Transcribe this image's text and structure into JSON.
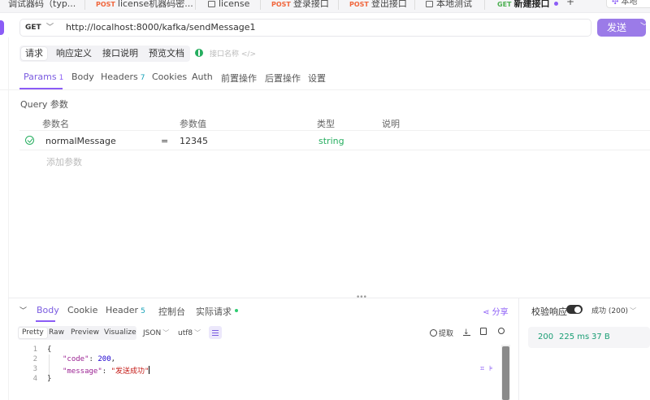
{
  "tabs": [
    {
      "method": "",
      "label": "调试器码（typ..."
    },
    {
      "method": "POST",
      "label": "license机器码密..."
    },
    {
      "method": "",
      "label": "license",
      "icon": "file-icon"
    },
    {
      "method": "POST",
      "label": "登录接口"
    },
    {
      "method": "POST",
      "label": "登出接口"
    },
    {
      "method": "",
      "label": "本地测试",
      "icon": "file-icon"
    },
    {
      "method": "GET",
      "label": "新建接口",
      "active": true
    }
  ],
  "tab_actions": {
    "add": "+",
    "more": "···",
    "env_label": "本地"
  },
  "request": {
    "method": "GET",
    "url": "http://localhost:8000/kafka/sendMessage1",
    "send_label": "发送"
  },
  "subtabs": [
    "请求",
    "响应定义",
    "接口说明",
    "预览文档"
  ],
  "api_name_placeholder": "接口名称",
  "param_tabs": [
    {
      "label": "Params",
      "count": "1",
      "active": true
    },
    {
      "label": "Body"
    },
    {
      "label": "Headers",
      "count": "7"
    },
    {
      "label": "Cookies"
    },
    {
      "label": "Auth"
    },
    {
      "label": "前置操作"
    },
    {
      "label": "后置操作"
    },
    {
      "label": "设置"
    }
  ],
  "query": {
    "title": "Query 参数",
    "columns": [
      "参数名",
      "参数值",
      "类型",
      "说明"
    ],
    "rows": [
      {
        "name": "normalMessage",
        "eq": "=",
        "value": "12345",
        "type": "string",
        "desc": ""
      }
    ],
    "add_placeholder": "添加参数"
  },
  "response": {
    "tabs": [
      {
        "label": "Body",
        "active": true
      },
      {
        "label": "Cookie"
      },
      {
        "label": "Header",
        "count": "5"
      },
      {
        "label": "控制台"
      },
      {
        "label": "实际请求"
      }
    ],
    "share_label": "分享",
    "formats": [
      "Pretty",
      "Raw",
      "Preview",
      "Visualize"
    ],
    "lang": "JSON",
    "encoding": "utf8",
    "extract_label": "提取",
    "code_lines": [
      "{",
      "\"code\": 200,",
      "\"message\": \"发送成功\"",
      "}"
    ],
    "code_parts": {
      "key1": "\"code\"",
      "val1": "200",
      "key2": "\"message\"",
      "val2": "\"发送成功\""
    },
    "validate_label": "校验响应",
    "status_select": "成功 (200)",
    "status": "200",
    "time": "225 ms",
    "size": "37 B"
  }
}
